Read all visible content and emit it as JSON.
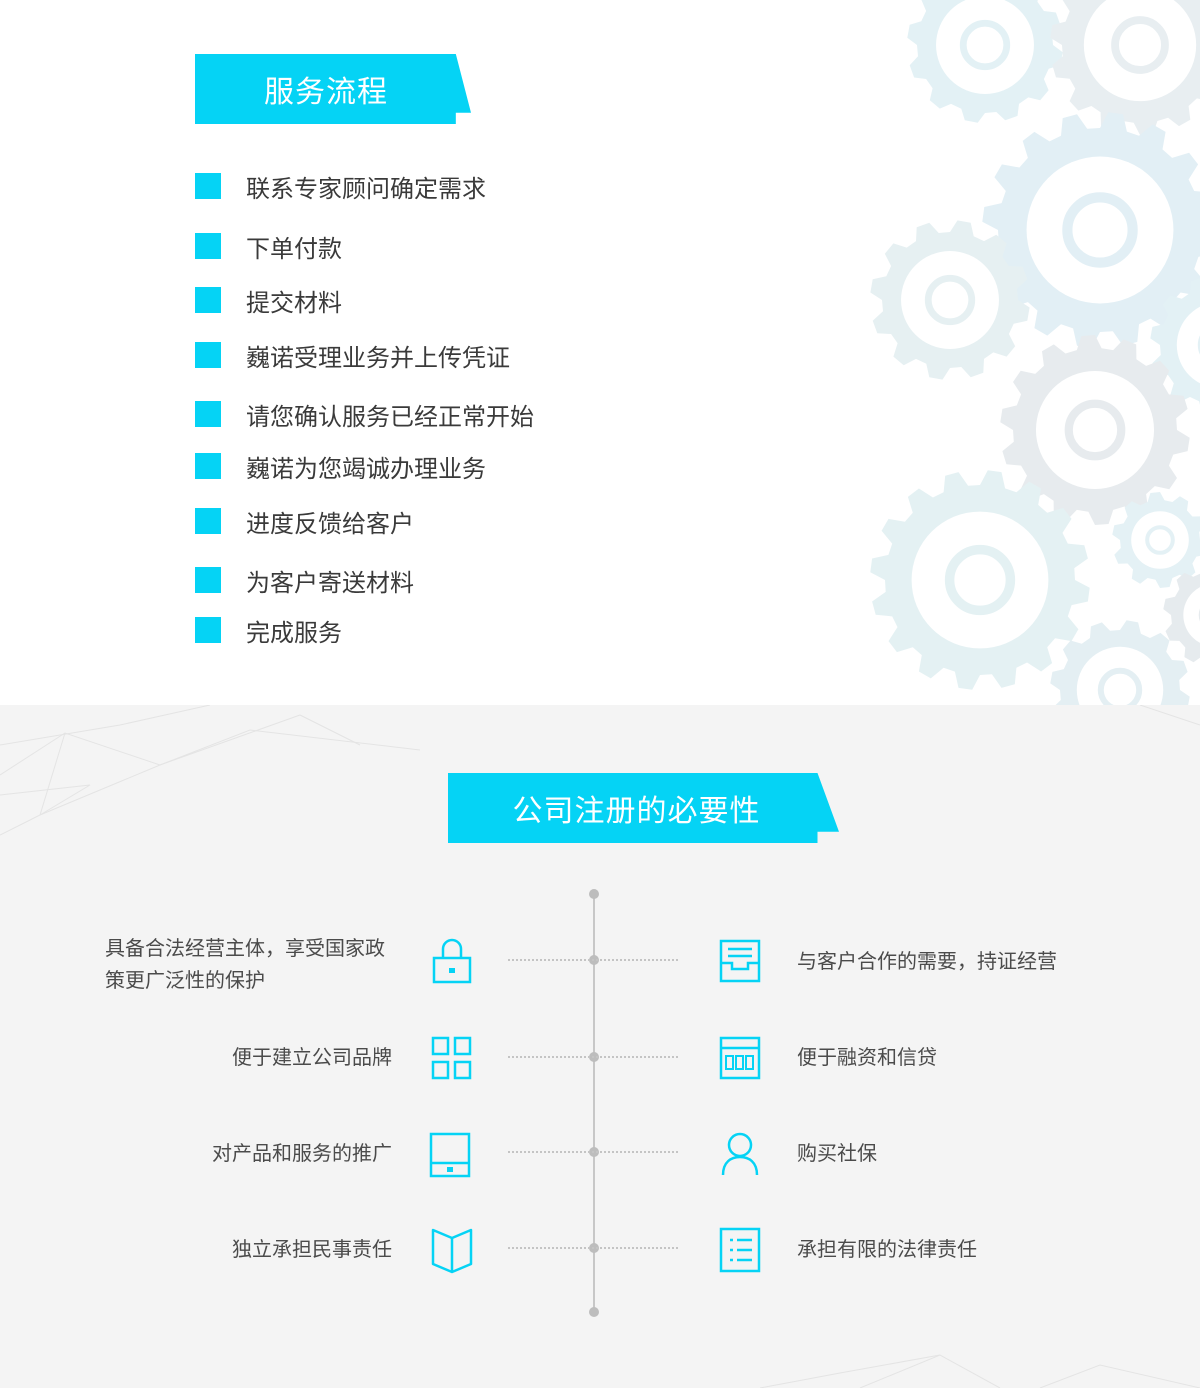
{
  "colors": {
    "accent": "#05d3f5",
    "text": "#3a3a3a",
    "muted_text": "#4b4b4b",
    "section2_bg": "#f4f4f4"
  },
  "service_flow": {
    "title": "服务流程",
    "steps": [
      "联系专家顾问确定需求",
      "下单付款",
      "提交材料",
      "巍诺受理业务并上传凭证",
      "请您确认服务已经正常开始",
      "巍诺为您竭诚办理业务",
      "进度反馈给客户",
      "为客户寄送材料",
      "完成服务"
    ],
    "decorative_icons": [
      "link-gear-icon",
      "broken-frame-gear-icon",
      "magnifier-gear-icon",
      "chart-gear-icon",
      "settings-gear-icon",
      "tablet-gear-icon",
      "target-gear-icon",
      "pencil-gear-icon",
      "clock-gear-icon",
      "globe-gear-icon"
    ]
  },
  "necessity": {
    "title": "公司注册的必要性",
    "left_items": [
      {
        "text": "具备合法经营主体，享受国家政策更广泛性的保护",
        "icon": "lock-icon"
      },
      {
        "text": "便于建立公司品牌",
        "icon": "grid-icon"
      },
      {
        "text": "对产品和服务的推广",
        "icon": "tablet-icon"
      },
      {
        "text": "独立承担民事责任",
        "icon": "book-icon"
      }
    ],
    "right_items": [
      {
        "text": "与客户合作的需要，持证经营",
        "icon": "inbox-icon"
      },
      {
        "text": "便于融资和信贷",
        "icon": "calculator-icon"
      },
      {
        "text": "购买社保",
        "icon": "user-icon"
      },
      {
        "text": "承担有限的法律责任",
        "icon": "list-icon"
      }
    ]
  }
}
